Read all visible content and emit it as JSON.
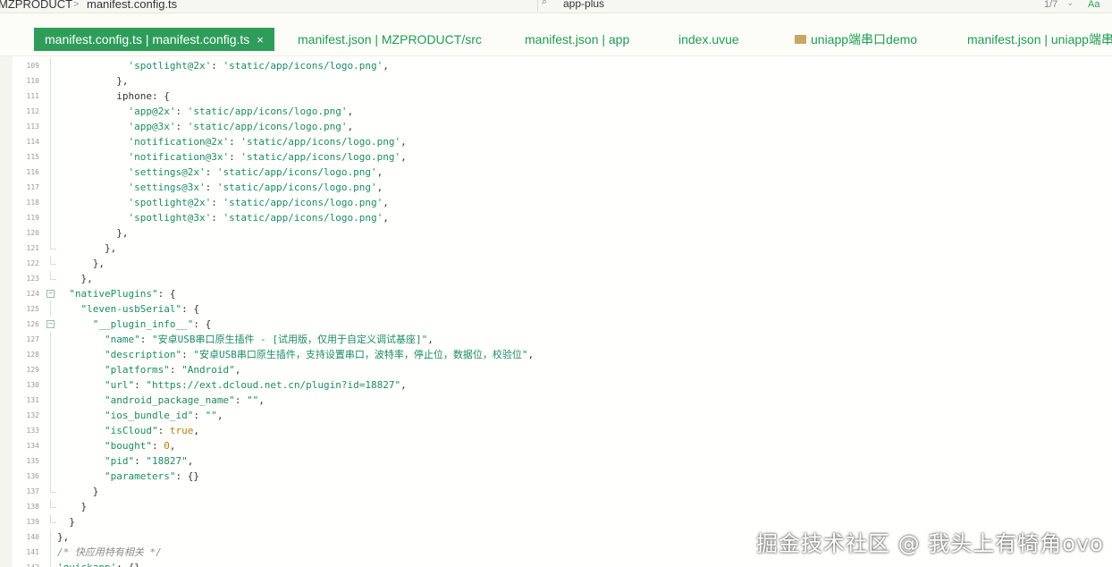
{
  "breadcrumb": {
    "project": "MZPRODUCT",
    "file": "manifest.config.ts",
    "separator": ">"
  },
  "search": {
    "icon": "search-icon",
    "value": "app-plus",
    "count": "1/7",
    "nav": "⌄",
    "match_case": "Aa"
  },
  "tabs": [
    {
      "label": "manifest.config.ts | manifest.config.ts",
      "active": true,
      "close": "×"
    },
    {
      "label": "manifest.json | MZPRODUCT/src",
      "active": false
    },
    {
      "label": "manifest.json | app",
      "active": false
    },
    {
      "label": "index.uvue",
      "active": false
    },
    {
      "label": "uniapp端串口demo",
      "active": false,
      "icon": "folder-icon"
    },
    {
      "label": "manifest.json | uniapp端串",
      "active": false
    }
  ],
  "editor": {
    "lines": [
      {
        "no": "109",
        "code": "            'spotlight@2x': 'static/app/icons/logo.png',",
        "fold": "guide"
      },
      {
        "no": "110",
        "code": "          },",
        "fold": "guide"
      },
      {
        "no": "111",
        "code": "          iphone: {",
        "fold": "guide"
      },
      {
        "no": "112",
        "code": "            'app@2x': 'static/app/icons/logo.png',",
        "fold": "guide"
      },
      {
        "no": "113",
        "code": "            'app@3x': 'static/app/icons/logo.png',",
        "fold": "guide"
      },
      {
        "no": "114",
        "code": "            'notification@2x': 'static/app/icons/logo.png',",
        "fold": "guide"
      },
      {
        "no": "115",
        "code": "            'notification@3x': 'static/app/icons/logo.png',",
        "fold": "guide"
      },
      {
        "no": "116",
        "code": "            'settings@2x': 'static/app/icons/logo.png',",
        "fold": "guide"
      },
      {
        "no": "117",
        "code": "            'settings@3x': 'static/app/icons/logo.png',",
        "fold": "guide"
      },
      {
        "no": "118",
        "code": "            'spotlight@2x': 'static/app/icons/logo.png',",
        "fold": "guide"
      },
      {
        "no": "119",
        "code": "            'spotlight@3x': 'static/app/icons/logo.png',",
        "fold": "guide"
      },
      {
        "no": "120",
        "code": "          },",
        "fold": "guide"
      },
      {
        "no": "121",
        "code": "        },",
        "fold": "end"
      },
      {
        "no": "122",
        "code": "      },",
        "fold": "end"
      },
      {
        "no": "123",
        "code": "    },",
        "fold": "end"
      },
      {
        "no": "124",
        "code": "  \"nativePlugins\": {",
        "fold": "box"
      },
      {
        "no": "125",
        "code": "    \"leven-usbSerial\": {",
        "fold": "guide"
      },
      {
        "no": "126",
        "code": "      \"__plugin_info__\": {",
        "fold": "box"
      },
      {
        "no": "127",
        "code": "        \"name\": \"安卓USB串口原生插件 - [试用版，仅用于自定义调试基座]\",",
        "fold": "guide"
      },
      {
        "no": "128",
        "code": "        \"description\": \"安卓USB串口原生插件，支持设置串口，波特率，停止位，数据位，校验位\",",
        "fold": "guide"
      },
      {
        "no": "129",
        "code": "        \"platforms\": \"Android\",",
        "fold": "guide"
      },
      {
        "no": "130",
        "code": "        \"url\": \"https://ext.dcloud.net.cn/plugin?id=18827\",",
        "fold": "guide"
      },
      {
        "no": "131",
        "code": "        \"android_package_name\": \"\",",
        "fold": "guide"
      },
      {
        "no": "132",
        "code": "        \"ios_bundle_id\": \"\",",
        "fold": "guide"
      },
      {
        "no": "133",
        "code": "        \"isCloud\": true,",
        "fold": "guide"
      },
      {
        "no": "134",
        "code": "        \"bought\": 0,",
        "fold": "guide"
      },
      {
        "no": "135",
        "code": "        \"pid\": \"18827\",",
        "fold": "guide"
      },
      {
        "no": "136",
        "code": "        \"parameters\": {}",
        "fold": "guide"
      },
      {
        "no": "137",
        "code": "      }",
        "fold": "end"
      },
      {
        "no": "138",
        "code": "    }",
        "fold": "end"
      },
      {
        "no": "139",
        "code": "  }",
        "fold": "end"
      },
      {
        "no": "140",
        "code": "},",
        "fold": "guide"
      },
      {
        "no": "141",
        "code": "/* 快应用特有相关 */",
        "fold": "guide"
      },
      {
        "no": "142",
        "code": "'quickapp': {},",
        "fold": "guide"
      }
    ]
  },
  "watermark": "掘金技术社区 @ 我头上有犄角ovo"
}
